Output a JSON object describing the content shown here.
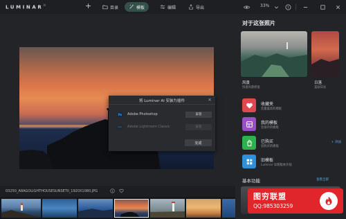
{
  "app": {
    "logo": "LUMINAR",
    "logo_sup": "AI"
  },
  "toolbar": {
    "add_icon": "plus-icon",
    "tabs": [
      {
        "label": "目录",
        "icon": "folder-icon",
        "active": false
      },
      {
        "label": "模板",
        "icon": "magic-wand-icon",
        "active": true
      },
      {
        "label": "编辑",
        "icon": "sliders-icon",
        "active": false
      },
      {
        "label": "导出",
        "icon": "export-icon",
        "active": false
      }
    ],
    "zoom": "33%",
    "accent": "#34504a"
  },
  "canvas": {
    "dialog": {
      "title": "将 Luminar AI 安装为插件",
      "plugins": [
        {
          "icon_label": "Ps",
          "name": "Adobe Photoshop",
          "button": "安装",
          "enabled": true
        },
        {
          "icon_label": "Lrc",
          "name": "Adobe Lightroom Classic",
          "button": "安装",
          "enabled": false
        }
      ],
      "done_label": "完成"
    }
  },
  "filmstrip": {
    "filename": "03250_ARAGOLIGHTHOUSESUNSETII_1920X1080.JPG"
  },
  "right_panel": {
    "title": "对于这张照片",
    "featured": [
      {
        "title": "风景",
        "subtitle": "快速风景修复"
      },
      {
        "title": "日落",
        "subtitle": "美丽日光"
      }
    ],
    "categories": [
      {
        "title": "收藏夹",
        "subtitle": "您最喜欢的模板",
        "icon": "heart-icon",
        "color": "#e0484f",
        "link": ""
      },
      {
        "title": "我的模板",
        "subtitle": "您保存的模板",
        "icon": "template-icon",
        "color": "#9a4fc6",
        "link": ""
      },
      {
        "title": "已购买",
        "subtitle": "您购买的模板",
        "icon": "shopping-icon",
        "color": "#2fb24e",
        "link": "+ 添加"
      },
      {
        "title": "旧模板",
        "subtitle": "Luminar 早期版本外观",
        "icon": "legacy-template-icon",
        "color": "#2f8fd8",
        "link": ""
      }
    ],
    "basic_title": "基本功能",
    "see_all": "查看全部"
  },
  "watermark": {
    "title": "图穷联盟",
    "subtitle": "QQ:985303259",
    "color": "#e0262a"
  }
}
